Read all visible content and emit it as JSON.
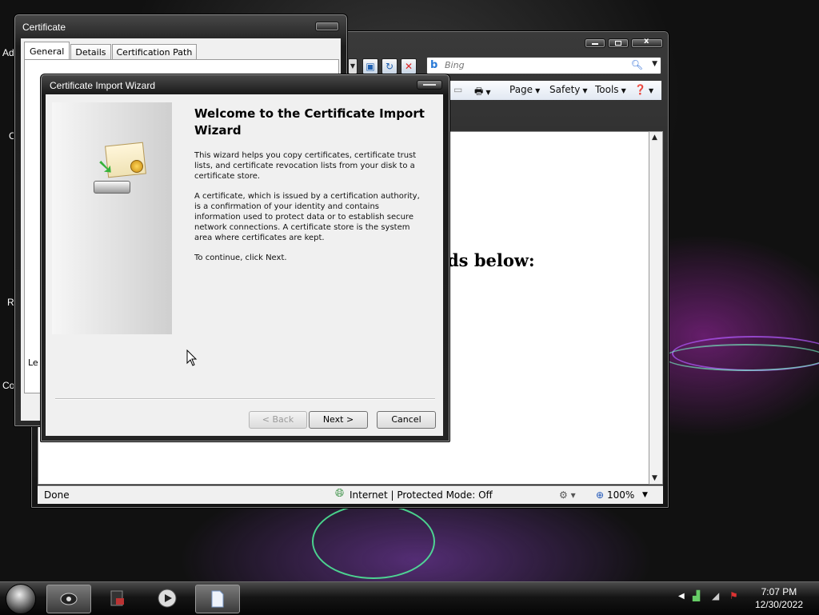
{
  "desktop": {
    "labels": [
      "Ad",
      "C",
      "R",
      "Co"
    ]
  },
  "ie": {
    "search_placeholder": "Bing",
    "commands": [
      "Page",
      "Safety",
      "Tools"
    ],
    "heading_fragment": "ds below:",
    "status": {
      "left": "Done",
      "zone": "Internet | Protected Mode: Off",
      "zoom": "100%"
    }
  },
  "cert": {
    "title": "Certificate",
    "tabs": [
      "General",
      "Details",
      "Certification Path"
    ],
    "partial_label": "Le"
  },
  "wizard": {
    "title": "Certificate Import Wizard",
    "heading": "Welcome to the Certificate Import Wizard",
    "p1": "This wizard helps you copy certificates, certificate trust lists, and certificate revocation lists from your disk to a certificate store.",
    "p2": "A certificate, which is issued by a certification authority, is a confirmation of your identity and contains information used to protect data or to establish secure network connections. A certificate store is the system area where certificates are kept.",
    "p3": "To continue, click Next.",
    "buttons": {
      "back": "< Back",
      "next": "Next >",
      "cancel": "Cancel"
    }
  },
  "taskbar": {
    "time": "7:07 PM",
    "date": "12/30/2022"
  },
  "colors": {
    "accent_blue": "#2a6ad6",
    "internet_globe": "#2e8a3a"
  }
}
